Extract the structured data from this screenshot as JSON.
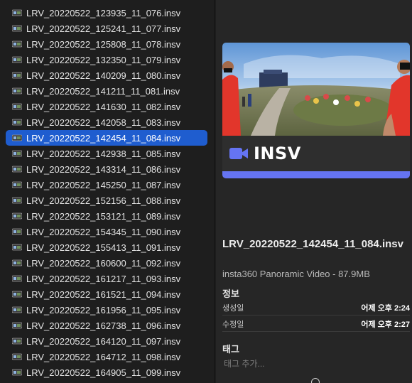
{
  "files": [
    "LRV_20220522_123935_11_076.insv",
    "LRV_20220522_125241_11_077.insv",
    "LRV_20220522_125808_11_078.insv",
    "LRV_20220522_132350_11_079.insv",
    "LRV_20220522_140209_11_080.insv",
    "LRV_20220522_141211_11_081.insv",
    "LRV_20220522_141630_11_082.insv",
    "LRV_20220522_142058_11_083.insv",
    "LRV_20220522_142454_11_084.insv",
    "LRV_20220522_142938_11_085.insv",
    "LRV_20220522_143314_11_086.insv",
    "LRV_20220522_145250_11_087.insv",
    "LRV_20220522_152156_11_088.insv",
    "LRV_20220522_153121_11_089.insv",
    "LRV_20220522_154345_11_090.insv",
    "LRV_20220522_155413_11_091.insv",
    "LRV_20220522_160600_11_092.insv",
    "LRV_20220522_161217_11_093.insv",
    "LRV_20220522_161521_11_094.insv",
    "LRV_20220522_161956_11_095.insv",
    "LRV_20220522_162738_11_096.insv",
    "LRV_20220522_164120_11_097.insv",
    "LRV_20220522_164712_11_098.insv",
    "LRV_20220522_164905_11_099.insv"
  ],
  "selected_index": 8,
  "preview": {
    "badge_text": "INSV",
    "badge_icon": "video-camera-icon",
    "accent_color": "#6574f3"
  },
  "info": {
    "filename": "LRV_20220522_142454_11_084.insv",
    "kind_size": "insta360 Panoramic Video - 87.9MB",
    "section_info": "정보",
    "created_label": "생성일",
    "created_value": "어제 오후 2:24",
    "modified_label": "수정일",
    "modified_value": "어제 오후 2:27",
    "section_tags": "태그",
    "tag_placeholder": "태그 추가..."
  },
  "colors": {
    "selection": "#1f5dcf",
    "sidebar_bg": "#1e1e1e",
    "inspector_bg": "#262626"
  }
}
